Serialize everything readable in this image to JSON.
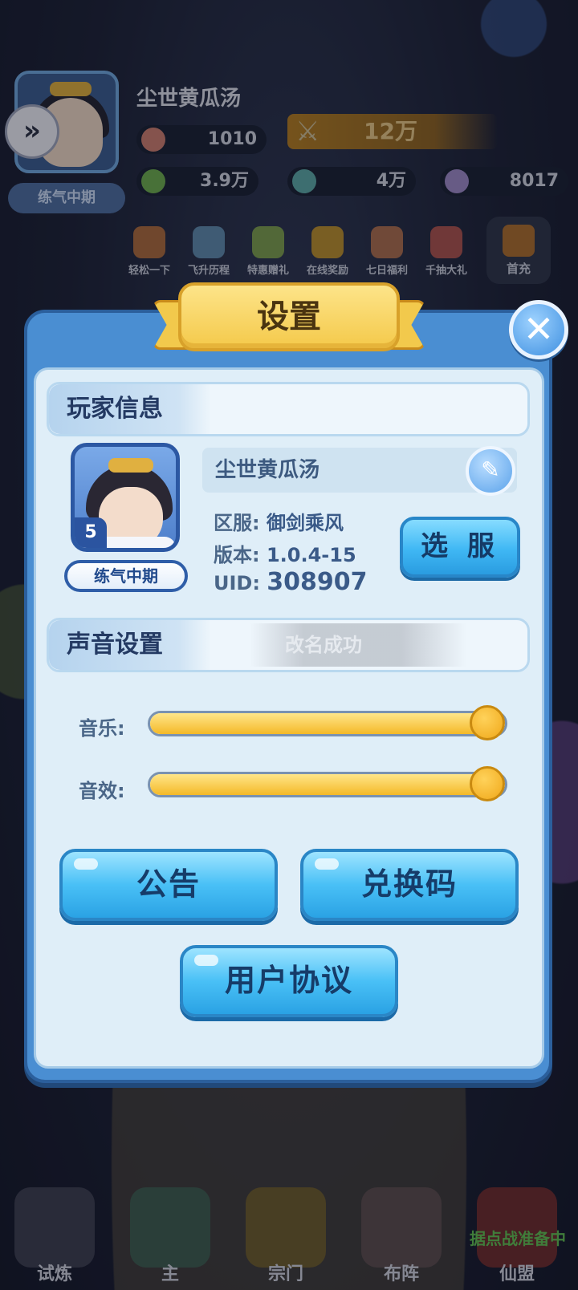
{
  "hud": {
    "player_name": "尘世黄瓜汤",
    "realm": "练气中期",
    "resources": [
      {
        "name": "peach",
        "value": "1010"
      },
      {
        "name": "leaf",
        "value": "3.9万"
      },
      {
        "name": "jade",
        "value": "4万"
      },
      {
        "name": "rainbow",
        "value": "8017"
      }
    ],
    "power": "12万",
    "activities": [
      "轻松一下",
      "飞升历程",
      "特惠赠礼",
      "在线奖励",
      "七日福利",
      "千抽大礼"
    ],
    "first_charge": "首充",
    "bottom_nav": [
      "试炼",
      "主",
      "宗门",
      "布阵",
      "仙盟"
    ],
    "bottom_nav_notice": "据点战准备中"
  },
  "settings": {
    "title": "设置",
    "player_info": {
      "header": "玩家信息",
      "name": "尘世黄瓜汤",
      "level": "5",
      "realm": "练气中期",
      "server_label": "区服:",
      "server_value": "御剑乘风",
      "version_label": "版本:",
      "version_value": "1.0.4-15",
      "uid_label": "UID:",
      "uid_value": "308907",
      "select_server_button": "选 服"
    },
    "sound": {
      "header": "声音设置",
      "toast": "改名成功",
      "music_label": "音乐:",
      "music_level": 1.0,
      "sfx_label": "音效:",
      "sfx_level": 1.0
    },
    "buttons": {
      "announcement": "公告",
      "redeem_code": "兑换码",
      "user_agreement": "用户协议"
    }
  },
  "colors": {
    "panel_blue": "#4a8ed2",
    "button_blue": "#49c0f6",
    "ribbon_gold": "#f4c94a",
    "slider_fill": "#f4b928"
  }
}
